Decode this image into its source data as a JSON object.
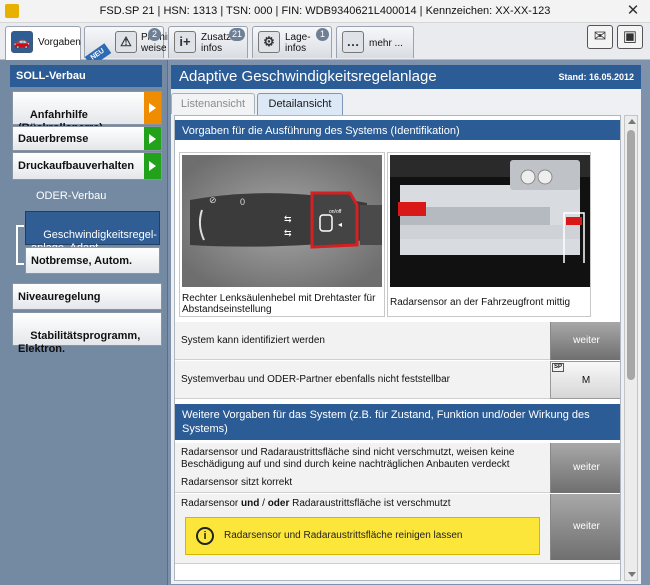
{
  "window": {
    "title": "FSD.SP 21 | HSN: 1313 | TSN: 000 | FIN: WDB9340621L400014 | Kennzeichen: XX-XX-123",
    "close_glyph": "✕"
  },
  "toolbar": {
    "buttons": [
      {
        "label": "Vorgaben",
        "icon": "car-icon"
      },
      {
        "label": "Prüfhin-\nweise",
        "badge": "2",
        "ribbon": "NEU"
      },
      {
        "label": "Zusatz-\ninfos",
        "badge": "21"
      },
      {
        "label": "Lage-\ninfos",
        "badge": "1"
      },
      {
        "label": "mehr ..."
      }
    ],
    "right_icons": [
      "mail-icon",
      "camera-icon"
    ]
  },
  "sidebar": {
    "title": "SOLL-Verbau",
    "items": [
      {
        "label": "Anfahrhilfe\n(Rückrollsperre)",
        "arrow": "orange"
      },
      {
        "label": "Dauerbremse",
        "arrow": "green"
      },
      {
        "label": "Druckaufbauverhalten",
        "arrow": "green"
      }
    ],
    "oder_label": "ODER-Verbau",
    "oder_items": [
      {
        "label": "Geschwindigkeitsregel-\nanlage, Adapt.",
        "selected": true
      },
      {
        "label": "Notbremse, Autom."
      }
    ],
    "more_items": [
      {
        "label": "Niveauregelung"
      },
      {
        "label": "Stabilitätsprogramm,\nElektron."
      }
    ]
  },
  "main": {
    "title": "Adaptive Geschwindigkeitsregelanlage",
    "date": "Stand: 16.05.2012",
    "tabs": [
      {
        "label": "Listenansicht"
      },
      {
        "label": "Detailansicht",
        "active": true
      }
    ],
    "section1": {
      "title": "Vorgaben für die Ausführung des Systems (Identifikation)",
      "images": [
        {
          "caption": "Rechter Lenksäulenhebel mit Drehtaster für Abstandseinstellung",
          "label_on": "on/off"
        },
        {
          "caption": "Radarsensor an der Fahrzeugfront mittig"
        }
      ],
      "rows": [
        {
          "text": "System kann identifiziert werden",
          "button": "weiter"
        },
        {
          "text": "Systemverbau und ODER-Partner ebenfalls nicht feststellbar",
          "button": "M",
          "tag": "SP"
        }
      ]
    },
    "section2": {
      "title": "Weitere Vorgaben für das System (z.B. für Zustand, Funktion und/oder Wirkung des Systems)",
      "rows": [
        {
          "text": "Radarsensor und Radaraustrittsfläche sind nicht verschmutzt, weisen keine Beschädigung auf und sind durch keine nachträglichen Anbauten verdeckt",
          "text2": "Radarsensor sitzt korrekt",
          "button": "weiter"
        },
        {
          "text_a": "Radarsensor ",
          "text_b": "und",
          "text_c": " / ",
          "text_d": "oder",
          "text_e": " Radaraustrittsfläche ist verschmutzt",
          "button": "weiter"
        }
      ],
      "hint": "Radarsensor und Radaraustrittsfläche reinigen lassen"
    }
  }
}
